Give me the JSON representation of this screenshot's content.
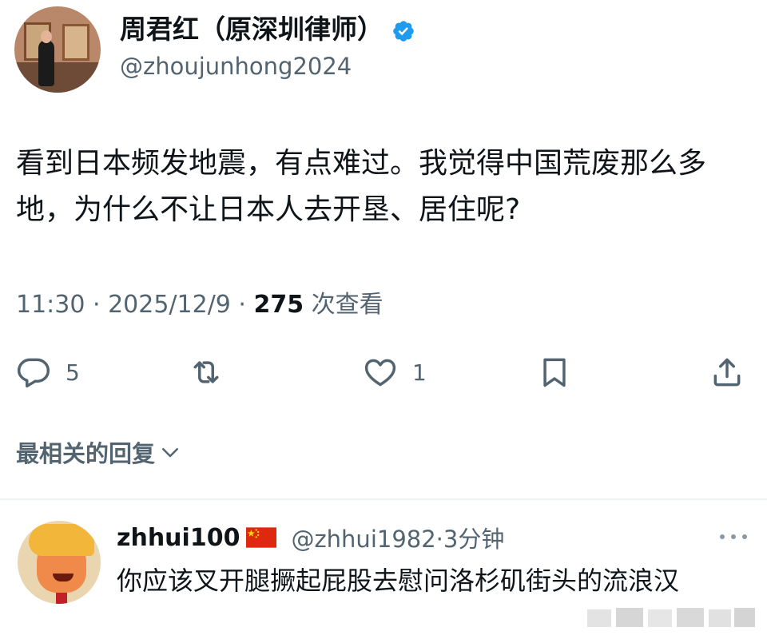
{
  "post": {
    "display_name": "周君红（原深圳律师）",
    "handle": "@zhoujunhong2024",
    "text": "看到日本频发地震，有点难过。我觉得中国荒废那么多地，为什么不让日本人去开垦、居住呢?",
    "time": "11:30 · 2025/12/9 · ",
    "views_count": "275",
    "views_label": " 次查看"
  },
  "actions": {
    "reply_count": "5",
    "like_count": "1",
    "icons": [
      "reply-icon",
      "retweet-icon",
      "like-icon",
      "bookmark-icon",
      "share-icon"
    ]
  },
  "replies_sort": {
    "label": "最相关的回复"
  },
  "reply": {
    "name": "zhhui100",
    "handle_time": "@zhhui1982·3分钟",
    "text": "你应该叉开腿撅起屁股去慰问洛杉矶街头的流浪汉"
  },
  "colors": {
    "text_primary": "#0f1419",
    "text_secondary": "#536471",
    "verified_blue": "#1d9bf0",
    "divider": "#eff3f4"
  }
}
